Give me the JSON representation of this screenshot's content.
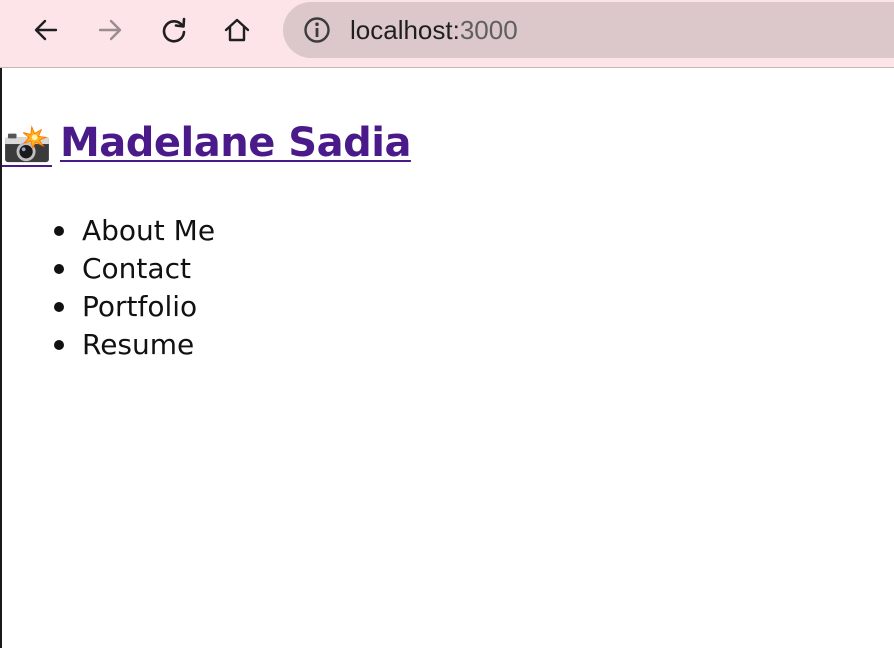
{
  "browser": {
    "url_host": "localhost:",
    "url_port": "3000",
    "icons": {
      "back": "arrow-left-icon",
      "forward": "arrow-right-icon",
      "reload": "reload-icon",
      "home": "home-icon",
      "info": "info-icon"
    },
    "colors": {
      "toolbar_bg": "#fde4e8",
      "address_bg": "#dcc8cb"
    }
  },
  "page": {
    "site_title": "Madelane Sadia",
    "title_icon": "camera-flash-icon",
    "title_color": "#4b1a8a",
    "nav_items": [
      {
        "label": "About Me"
      },
      {
        "label": "Contact"
      },
      {
        "label": "Portfolio"
      },
      {
        "label": "Resume"
      }
    ]
  }
}
